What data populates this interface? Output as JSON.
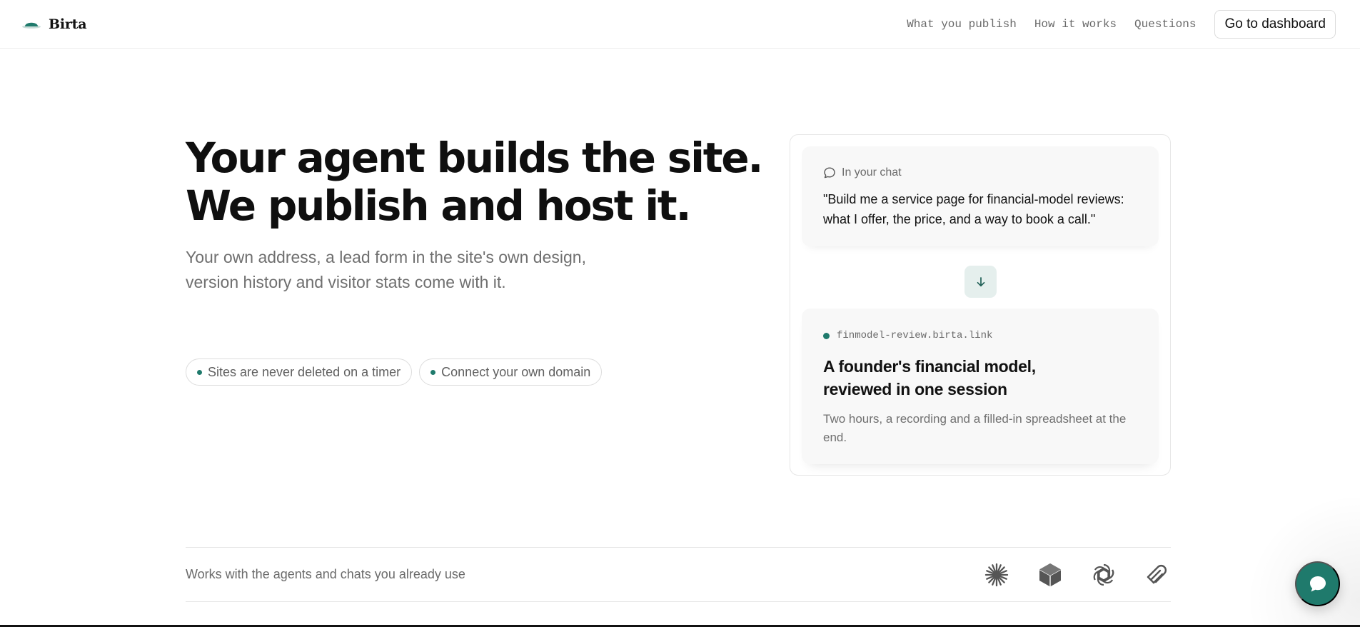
{
  "brand": {
    "name": "Birta"
  },
  "nav": {
    "links": [
      "What you publish",
      "How it works",
      "Questions"
    ],
    "cta": "Go to dashboard"
  },
  "hero": {
    "title_lines": [
      "Your agent builds the site.",
      "We publish and host it."
    ],
    "subtitle_lines": [
      "Your own address, a lead form in the site's own design,",
      "version history and visitor stats come with it."
    ],
    "pills": [
      "Sites are never deleted on a timer",
      "Connect your own domain"
    ]
  },
  "demo": {
    "chat_label": "In your chat",
    "chat_message": "\"Build me a service page for financial-model reviews: what I offer, the price, and a way to book a call.\"",
    "site_url": "finmodel-review.birta.link",
    "site_title_lines": [
      "A founder's financial model,",
      "reviewed in one session"
    ],
    "site_description": "Two hours, a recording and a filled-in spreadsheet at the end."
  },
  "works_with": {
    "text": "Works with the agents and chats you already use",
    "agents": [
      "claude-icon",
      "cursor-icon",
      "openai-icon",
      "windsurf-icon"
    ]
  },
  "colors": {
    "accent": "#1f7a6c",
    "accent_soft": "#e5efed",
    "text": "#111111",
    "muted": "#6f6f6f",
    "border": "#e6e6e6"
  },
  "fab": {
    "icon": "chat-bubble-icon"
  }
}
